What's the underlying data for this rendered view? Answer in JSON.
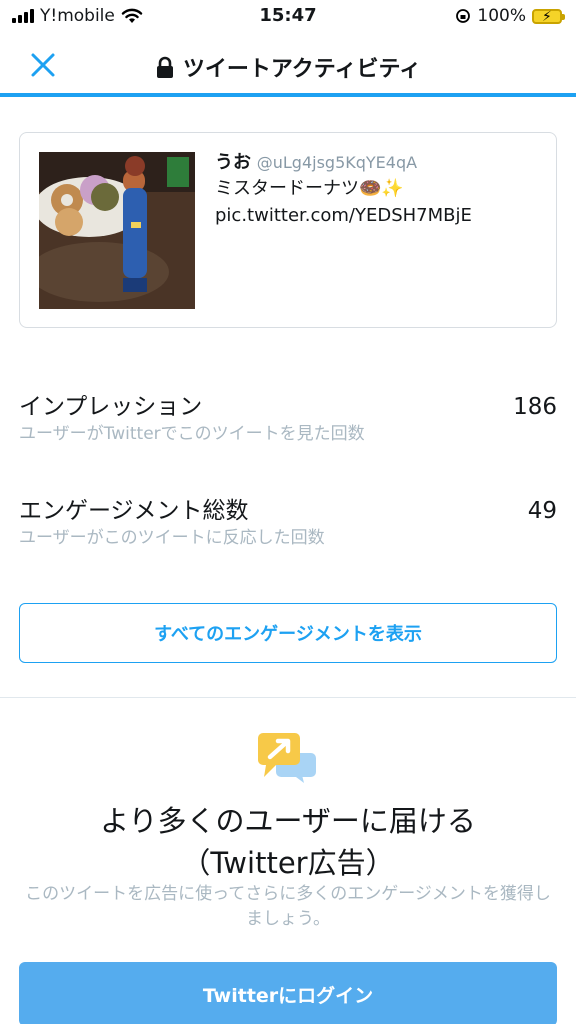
{
  "status_bar": {
    "carrier": "Y!mobile",
    "time": "15:47",
    "battery": "100%"
  },
  "nav": {
    "title": "ツイートアクティビティ"
  },
  "tweet": {
    "name": "うお",
    "handle": "@uLg4jsg5KqYE4qA",
    "text": "ミスタードーナツ🍩✨",
    "link": "pic.twitter.com/YEDSH7MBjE"
  },
  "metrics": [
    {
      "label": "インプレッション",
      "sub": "ユーザーがTwitterでこのツイートを見た回数",
      "value": "186"
    },
    {
      "label": "エンゲージメント総数",
      "sub": "ユーザーがこのツイートに反応した回数",
      "value": "49"
    }
  ],
  "all_engagements_button": "すべてのエンゲージメントを表示",
  "promo": {
    "title_line1": "より多くのユーザーに届ける",
    "title_line2": "（Twitter広告）",
    "description": "このツイートを広告に使ってさらに多くのエンゲージメントを獲得しましょう。"
  },
  "login_button": "Twitterにログイン",
  "colors": {
    "accent": "#1da1f2",
    "login_button": "#55acee",
    "muted_text": "#aab8c2"
  }
}
